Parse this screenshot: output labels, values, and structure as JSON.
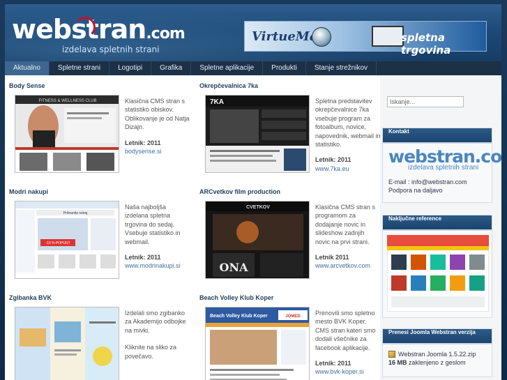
{
  "header": {
    "logo_main": "webstran",
    "logo_suffix": ".com",
    "logo_tagline": "izdelava spletnih strani",
    "banner_left": "VirtueMart",
    "banner_right": "spletna trgovina"
  },
  "nav": [
    {
      "label": "Aktualno"
    },
    {
      "label": "Spletne strani"
    },
    {
      "label": "Logotipi"
    },
    {
      "label": "Grafika"
    },
    {
      "label": "Spletne aplikacije"
    },
    {
      "label": "Produkti"
    },
    {
      "label": "Stanje strežnikov"
    }
  ],
  "references": [
    {
      "title": "Body Sense",
      "desc": "Klasična CMS stran s statistiko obiskov. Oblikovanje je od Natja Dizajn.",
      "year": "Letnik: 2011",
      "link": "bodysense.si"
    },
    {
      "title": "Okrepčevalnica 7ka",
      "desc": "Spletna predstavitev okrepčevalnice 7ka vsebuje program za fotoalbum, novice, napovednik, webmail in statistiko.",
      "year": "Letnik: 2011",
      "link": "www.7ka.eu"
    },
    {
      "title": "Modri nakupi",
      "desc": "Naša najboljša izdelana spletna trgovina do sedaj. Vsebuje statistiko in webmail.",
      "year": "Letnik: 2011",
      "link": "www.modrinakupi.si"
    },
    {
      "title": "ARCvetkov film production",
      "desc": "Klasična CMS stran s programom za dodajanje novic in slideshow zadnjih novic na prvi strani.",
      "year": "Letnik 2011",
      "link": "www.arcvetkov.com"
    },
    {
      "title": "Zgibanka BVK",
      "desc": "Izdelali smo zgibanko za Akademijo odbojke na mivki.",
      "extra": "Kliknite na sliko za povečavo.",
      "year": "",
      "link": ""
    },
    {
      "title": "Beach Volley Klub Koper",
      "desc": "Prenovili smo spletno mesto BVK Koper. CMS stran kateri smo dodali všečnike za facebook aplikacije.",
      "year": "Letnik: 2011",
      "link": "www.bvk-koper.si"
    }
  ],
  "thumb_labels": {
    "bodysense": "FITNESS & WELLNESS CLUB",
    "seven": "7KA",
    "modri_heading": "Prihranite nekaj",
    "modri_sale": "-10 % POPUST",
    "arc": "CVETKOV",
    "arc_bottom": "ONA",
    "bvk_title": "Beach Volley Klub Koper",
    "bvk_sponsor": "JOMED"
  },
  "sidebar": {
    "search_placeholder": "Iskanje...",
    "contact_title": "Kontakt",
    "contact_logo": "webstran.com",
    "contact_tagline": "izdelava spletnih strani",
    "email": "E-mail : info@webstran.com",
    "support": "Podpora na daljavo",
    "random_ref_title": "Naključne reference",
    "joomla_title": "Prenesi Joomla Webstran verzija",
    "joomla_file": "Webstran Joomla 1.5.22.zip",
    "joomla_size": "16 MB",
    "joomla_note": "zaklenjeno z geslom"
  },
  "colors": {
    "accent": "#3d6791",
    "nav_bg": "#1c3046",
    "link": "#3f6f9e"
  }
}
